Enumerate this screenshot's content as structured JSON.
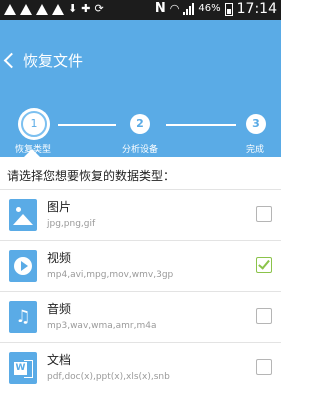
{
  "status_bar": {
    "battery": "46%",
    "time": "17:14",
    "notification_letter": "N",
    "left_icons": [
      "warning-icon",
      "warning-icon",
      "warning-icon",
      "warning-icon",
      "download-icon",
      "gamepad-icon",
      "sync-icon"
    ]
  },
  "header": {
    "title": "恢复文件",
    "background_color": "#5aabe6"
  },
  "steps": [
    {
      "number": "1",
      "label": "恢复类型",
      "active": true
    },
    {
      "number": "2",
      "label": "分析设备",
      "active": false
    },
    {
      "number": "3",
      "label": "完成",
      "active": false
    }
  ],
  "prompt": "请选择您想要恢复的数据类型：",
  "file_types": [
    {
      "name": "图片",
      "extensions": "jpg,png,gif",
      "icon": "image-icon",
      "checked": false
    },
    {
      "name": "视频",
      "extensions": "mp4,avi,mpg,mov,wmv,3gp",
      "icon": "video-icon",
      "checked": true
    },
    {
      "name": "音频",
      "extensions": "mp3,wav,wma,amr,m4a",
      "icon": "music-icon",
      "checked": false
    },
    {
      "name": "文档",
      "extensions": "pdf,doc(x),ppt(x),xls(x),snb",
      "icon": "document-icon",
      "checked": false
    }
  ],
  "colors": {
    "accent": "#5aabe6",
    "check": "#8bc34a"
  }
}
